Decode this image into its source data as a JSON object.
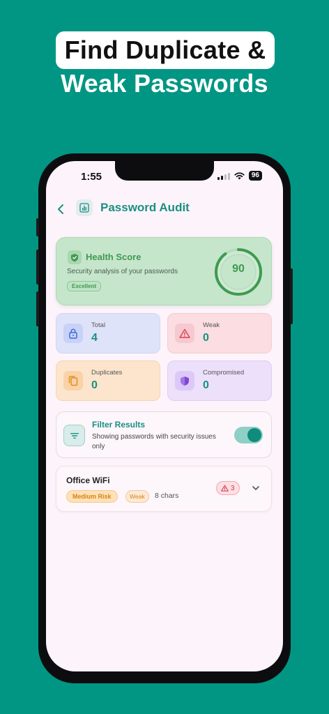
{
  "headline": {
    "line1": "Find Duplicate &",
    "line2": "Weak Passwords"
  },
  "status_bar": {
    "time": "1:55",
    "battery": "96"
  },
  "nav": {
    "title": "Password Audit",
    "back_icon": "chevron-left-icon",
    "page_icon": "chart-icon"
  },
  "health": {
    "title": "Health Score",
    "subtitle": "Security analysis of your passwords",
    "badge": "Excellent",
    "score": "90",
    "score_fraction": 0.9,
    "color": "#3f9a4f"
  },
  "stats": [
    {
      "label": "Total",
      "value": "4",
      "icon": "lock-icon",
      "color": "#3f6ad8"
    },
    {
      "label": "Weak",
      "value": "0",
      "icon": "warning-icon",
      "color": "#d8434f"
    },
    {
      "label": "Duplicates",
      "value": "0",
      "icon": "copy-icon",
      "color": "#e48f1a"
    },
    {
      "label": "Compromised",
      "value": "0",
      "icon": "shield-icon",
      "color": "#8146d6"
    }
  ],
  "filter": {
    "title": "Filter Results",
    "subtitle": "Showing passwords with security issues only",
    "enabled": true
  },
  "entries": [
    {
      "title": "Office WiFi",
      "risk": "Medium Risk",
      "strength": "Weak",
      "length": "8 chars",
      "issues": "3"
    }
  ],
  "colors": {
    "background": "#009683",
    "accent": "#1a9080",
    "screen": "#fcf4fa"
  }
}
